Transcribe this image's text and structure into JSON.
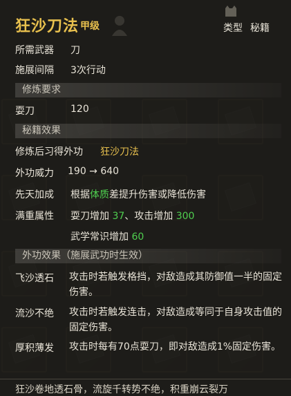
{
  "header": {
    "title": "狂沙刀法",
    "grade": "甲级",
    "type_label": "类型",
    "type_value": "秘籍"
  },
  "stats": {
    "weapon_label": "所需武器",
    "weapon_value": "刀",
    "interval_label": "施展间隔",
    "interval_value": "3次行动"
  },
  "requirements": {
    "section_label": "修炼要求",
    "skill_label": "耍刀",
    "skill_value": "120"
  },
  "effects": {
    "section_label": "秘籍效果",
    "learn_label": "修炼后习得外功",
    "learn_value": "狂沙刀法",
    "power_label": "外功威力",
    "power_value": "190 → 640",
    "bonus_label": "先天加成",
    "bonus_pre": "根据",
    "bonus_attr": "体质",
    "bonus_post": "差提升伤害或降低伤害",
    "max_label": "满重属性",
    "max_line1_a": "耍刀增加 ",
    "max_line1_b": "37",
    "max_line1_c": "、攻击增加 ",
    "max_line1_d": "300",
    "max_line2_a": "武学常识增加 ",
    "max_line2_b": "60"
  },
  "martial": {
    "section_label": "外功效果（施展武功时生效）",
    "skills": [
      {
        "name": "飞沙透石",
        "desc": "攻击时若触发格挡，对敌造成其防御值一半的固定伤害。"
      },
      {
        "name": "流沙不绝",
        "desc": "攻击时若触发连击，对敌造成等同于自身攻击值的固定伤害。"
      },
      {
        "name": "厚积薄发",
        "desc": "攻击时每有70点耍刀，即对敌造成1%固定伤害。"
      }
    ]
  },
  "flavor_text": "狂沙卷地透石骨，流旋千转势不绝，积重崩云裂万",
  "colors": {
    "gold": "#e8c04e",
    "green": "#4fcf4f",
    "background": "#1e1d1a"
  }
}
